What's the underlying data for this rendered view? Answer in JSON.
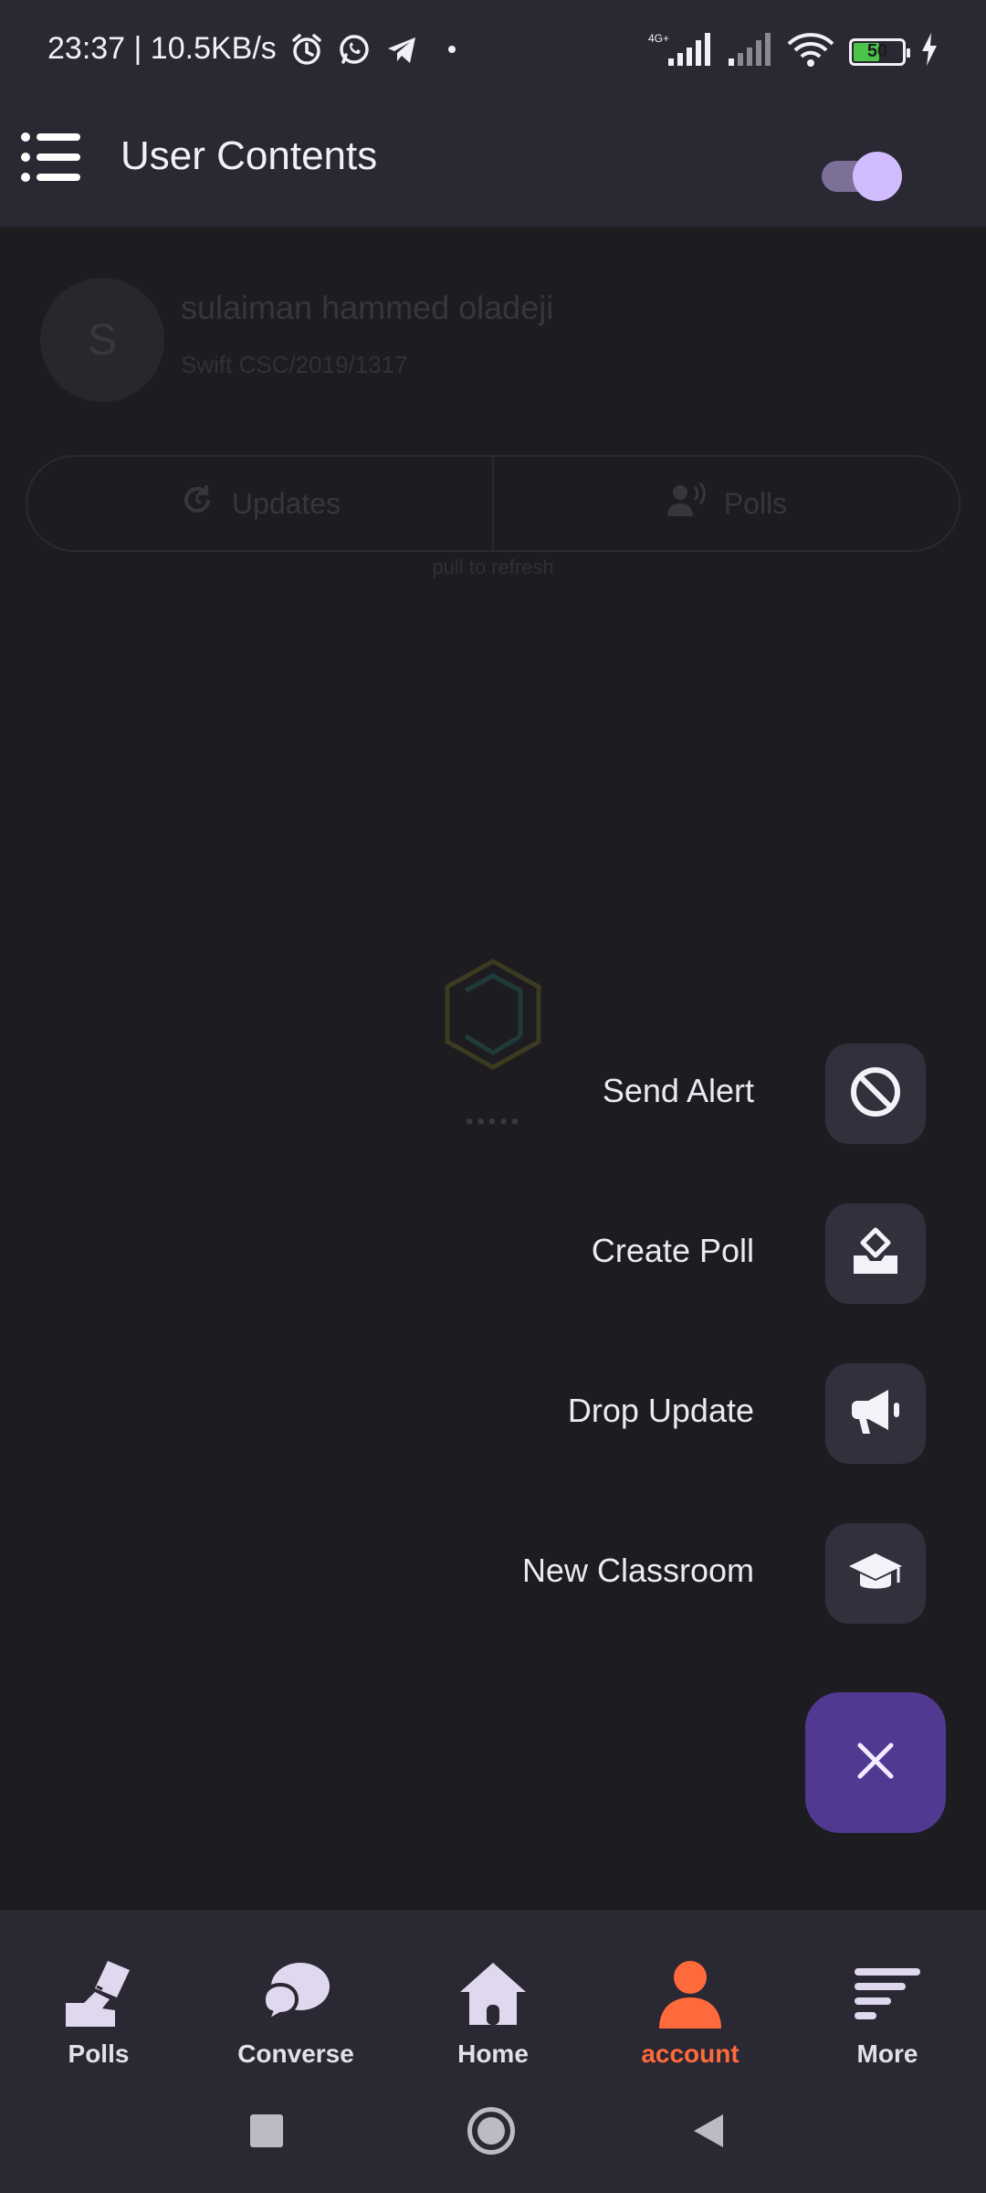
{
  "status_bar": {
    "time_speed": "23:37 | 10.5KB/s",
    "network_type": "4G+",
    "battery_level": "50",
    "colors": {
      "battery_fill": "#4cc34a"
    }
  },
  "app_bar": {
    "title": "User Contents",
    "menu_icon": "list-menu-icon",
    "toggle_state": "on"
  },
  "profile": {
    "avatar_initial": "S",
    "name": "sulaiman hammed oladeji",
    "id": "Swift CSC/2019/1317"
  },
  "tabs": [
    {
      "label": "Updates",
      "icon": "refresh-icon"
    },
    {
      "label": "Polls",
      "icon": "speaking-person-icon"
    }
  ],
  "pull_to_refresh": "pull to refresh",
  "loader_dots": "•••••",
  "fab_menu": {
    "items": [
      {
        "label": "Send Alert",
        "icon": "ban-icon"
      },
      {
        "label": "Create Poll",
        "icon": "ballot-box-icon"
      },
      {
        "label": "Drop Update",
        "icon": "megaphone-icon"
      },
      {
        "label": "New Classroom",
        "icon": "graduation-cap-icon"
      }
    ],
    "close_icon": "close-icon",
    "colors": {
      "fab": "#513992",
      "mini_fab": "#332f3c"
    }
  },
  "bottom_nav": {
    "items": [
      {
        "label": "Polls",
        "icon": "hand-ballot-icon"
      },
      {
        "label": "Converse",
        "icon": "chat-bubbles-icon"
      },
      {
        "label": "Home",
        "icon": "home-icon"
      },
      {
        "label": "account",
        "icon": "user-icon"
      },
      {
        "label": "More",
        "icon": "more-lines-icon"
      }
    ],
    "active": "account",
    "colors": {
      "active": "#ff6a3c"
    }
  }
}
